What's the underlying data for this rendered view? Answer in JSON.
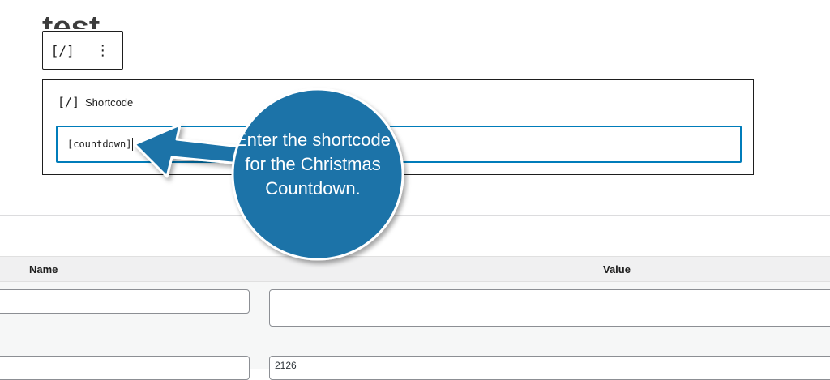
{
  "editor": {
    "post_title": "test",
    "toolbar": {
      "block_icon": "[/]",
      "more_icon": "⋮"
    },
    "shortcode_block": {
      "icon": "[/]",
      "label": "Shortcode",
      "value": "[countdown]"
    }
  },
  "custom_fields": {
    "headers": {
      "name": "Name",
      "value": "Value"
    },
    "rows": [
      {
        "name": "",
        "value": ""
      },
      {
        "name": "",
        "value": "2126"
      }
    ]
  },
  "callout": {
    "text": "Enter the shortcode for the Christmas Countdown.",
    "color": "#1a73a8"
  },
  "colors": {
    "accent": "#007cba",
    "panel_bg": "#f6f7f7"
  }
}
